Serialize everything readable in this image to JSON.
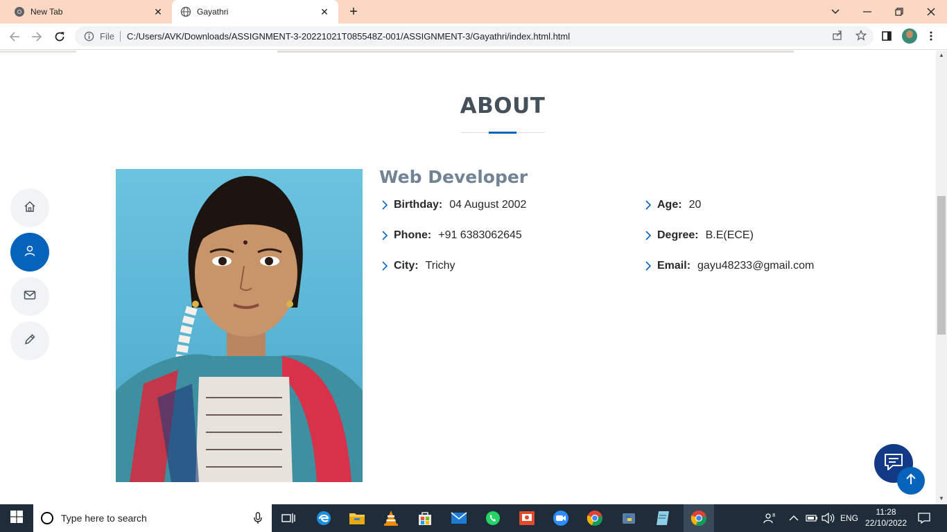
{
  "browser": {
    "tabs": [
      {
        "label": "New Tab"
      },
      {
        "label": "Gayathri"
      }
    ],
    "new_tab_symbol": "+",
    "address": {
      "scheme_label": "File",
      "url": "C:/Users/AVK/Downloads/ASSIGNMENT-3-20221021T085548Z-001/ASSIGNMENT-3/Gayathri/index.html.html"
    }
  },
  "about": {
    "section_title": "ABOUT",
    "role": "Web Developer",
    "details_left": [
      {
        "label": "Birthday:",
        "value": "04 August 2002"
      },
      {
        "label": "Phone:",
        "value": "+91 6383062645"
      },
      {
        "label": "City:",
        "value": "Trichy"
      }
    ],
    "details_right": [
      {
        "label": "Age:",
        "value": "20"
      },
      {
        "label": "Degree:",
        "value": "B.E(ECE)"
      },
      {
        "label": "Email:",
        "value": "gayu48233@gmail.com"
      }
    ]
  },
  "side_nav": {
    "items": [
      {
        "icon": "home-icon",
        "active": false
      },
      {
        "icon": "person-icon",
        "active": true
      },
      {
        "icon": "envelope-icon",
        "active": false
      },
      {
        "icon": "pencil-icon",
        "active": false
      }
    ]
  },
  "colors": {
    "accent": "#0563bb",
    "heading": "#45505b",
    "role": "#728394",
    "tab_strip": "#fbd8c4",
    "taskbar": "#1f2d3a"
  },
  "taskbar": {
    "search_placeholder": "Type here to search",
    "language": "ENG",
    "time": "11:28",
    "date": "22/10/2022"
  }
}
